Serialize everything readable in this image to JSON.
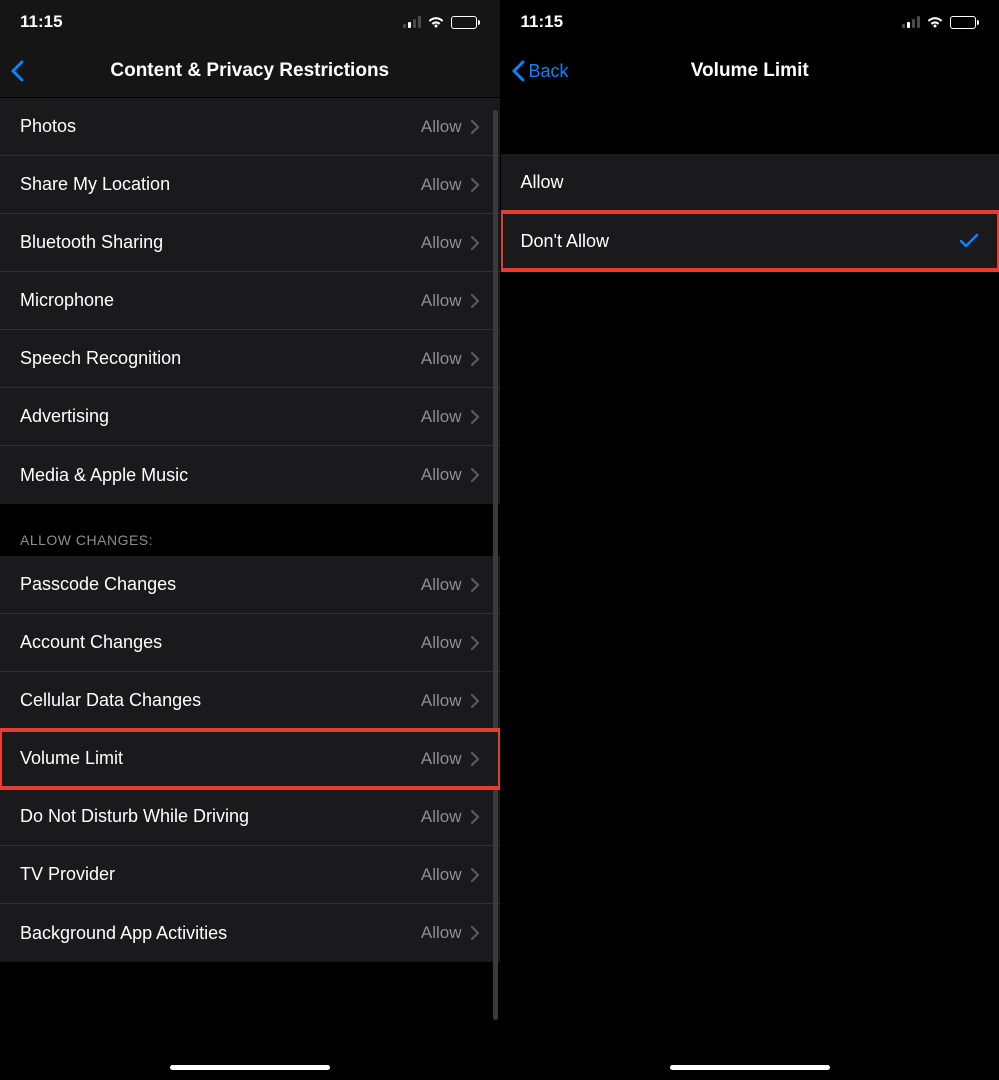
{
  "left": {
    "statusbar": {
      "time": "11:15"
    },
    "nav": {
      "title": "Content & Privacy Restrictions"
    },
    "group1": [
      {
        "label": "Photos",
        "value": "Allow"
      },
      {
        "label": "Share My Location",
        "value": "Allow"
      },
      {
        "label": "Bluetooth Sharing",
        "value": "Allow"
      },
      {
        "label": "Microphone",
        "value": "Allow"
      },
      {
        "label": "Speech Recognition",
        "value": "Allow"
      },
      {
        "label": "Advertising",
        "value": "Allow"
      },
      {
        "label": "Media & Apple Music",
        "value": "Allow"
      }
    ],
    "section2_header": "Allow Changes:",
    "group2": [
      {
        "label": "Passcode Changes",
        "value": "Allow",
        "highlight": false
      },
      {
        "label": "Account Changes",
        "value": "Allow",
        "highlight": false
      },
      {
        "label": "Cellular Data Changes",
        "value": "Allow",
        "highlight": false
      },
      {
        "label": "Volume Limit",
        "value": "Allow",
        "highlight": true
      },
      {
        "label": "Do Not Disturb While Driving",
        "value": "Allow",
        "highlight": false
      },
      {
        "label": "TV Provider",
        "value": "Allow",
        "highlight": false
      },
      {
        "label": "Background App Activities",
        "value": "Allow",
        "highlight": false
      }
    ]
  },
  "right": {
    "statusbar": {
      "time": "11:15"
    },
    "nav": {
      "back": "Back",
      "title": "Volume Limit"
    },
    "options": [
      {
        "label": "Allow",
        "selected": false,
        "highlight": false
      },
      {
        "label": "Don't Allow",
        "selected": true,
        "highlight": true
      }
    ]
  }
}
